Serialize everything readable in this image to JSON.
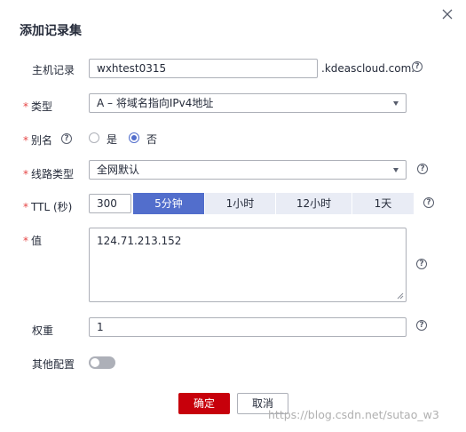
{
  "dialog": {
    "title": "添加记录集",
    "close_icon": "close-icon"
  },
  "host": {
    "label": "主机记录",
    "value": "wxhtest0315",
    "suffix": ".kdeascloud.com."
  },
  "type": {
    "label": "类型",
    "value": "A – 将域名指向IPv4地址"
  },
  "alias": {
    "label": "别名",
    "options": [
      "是",
      "否"
    ],
    "selected": "否"
  },
  "line": {
    "label": "线路类型",
    "value": "全网默认"
  },
  "ttl": {
    "label": "TTL (秒)",
    "value": "300",
    "presets": [
      "5分钟",
      "1小时",
      "12小时",
      "1天"
    ],
    "active_preset": "5分钟"
  },
  "value_field": {
    "label": "值",
    "value": "124.71.213.152"
  },
  "weight": {
    "label": "权重",
    "value": "1"
  },
  "other": {
    "label": "其他配置",
    "toggle_on": false
  },
  "footer": {
    "confirm_label": "确定",
    "cancel_label": "取消"
  },
  "watermark": "https://blog.csdn.net/sutao_w3",
  "help_glyph": "?",
  "colors": {
    "primary": "#c7000b",
    "accent": "#526ecc",
    "required": "#e54545",
    "segment_bg": "#e9ecf5"
  }
}
